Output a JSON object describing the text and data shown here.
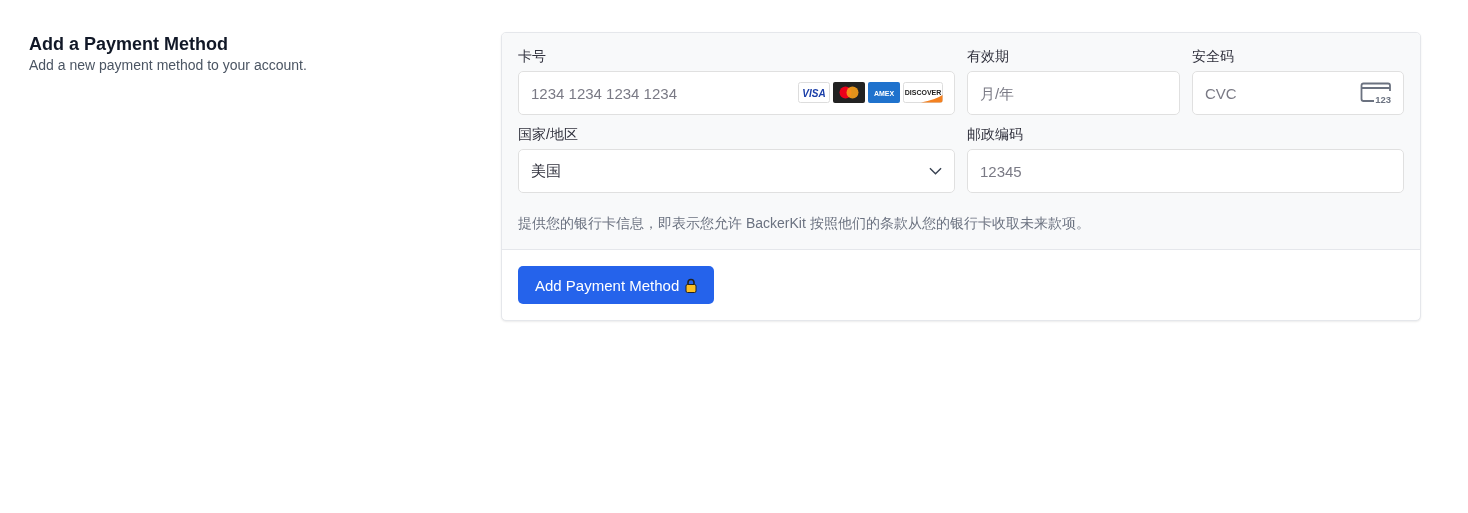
{
  "header": {
    "title": "Add a Payment Method",
    "subtitle": "Add a new payment method to your account."
  },
  "form": {
    "card_number": {
      "label": "卡号",
      "placeholder": "1234 1234 1234 1234",
      "brands": [
        {
          "kind": "visa",
          "label": "VISA"
        },
        {
          "kind": "mastercard"
        },
        {
          "kind": "amex",
          "label": "AMEX"
        },
        {
          "kind": "discover",
          "label": "DISCOVER"
        }
      ]
    },
    "expiry": {
      "label": "有效期",
      "placeholder": "月/年"
    },
    "cvc": {
      "label": "安全码",
      "placeholder": "CVC",
      "icon_text": "123"
    },
    "country": {
      "label": "国家/地区",
      "value": "美国"
    },
    "postal_code": {
      "label": "邮政编码",
      "placeholder": "12345"
    },
    "notice": "提供您的银行卡信息，即表示您允许 BackerKit 按照他们的条款从您的银行卡收取未来款项。"
  },
  "submit_button": {
    "label": "Add Payment Method"
  }
}
